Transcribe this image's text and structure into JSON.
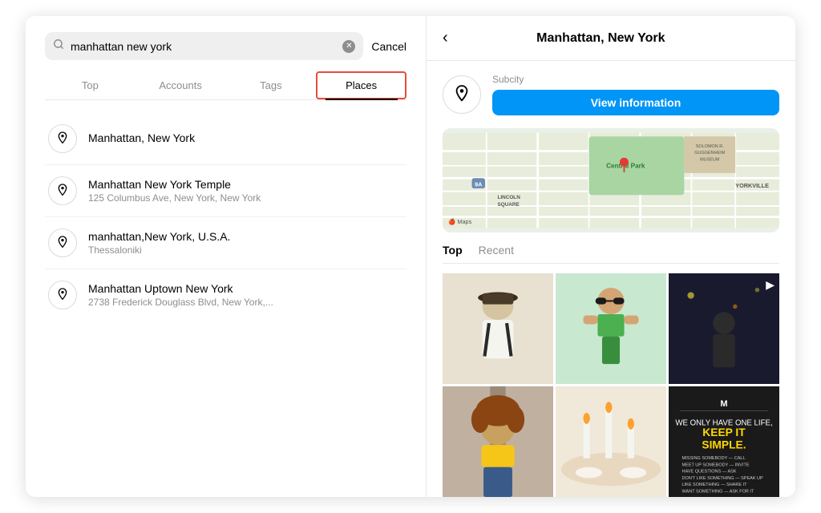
{
  "search": {
    "query": "manhattan new york",
    "placeholder": "Search",
    "cancel_label": "Cancel"
  },
  "tabs": {
    "items": [
      {
        "label": "Top",
        "active": false
      },
      {
        "label": "Accounts",
        "active": false
      },
      {
        "label": "Tags",
        "active": false
      },
      {
        "label": "Places",
        "active": true
      }
    ]
  },
  "results": [
    {
      "title": "Manhattan, New York",
      "subtitle": ""
    },
    {
      "title": "Manhattan New York Temple",
      "subtitle": "125 Columbus Ave, New York, New York"
    },
    {
      "title": "manhattan,New York, U.S.A.",
      "subtitle": "Thessaloniki"
    },
    {
      "title": "Manhattan Uptown New York",
      "subtitle": "2738 Frederick Douglass Blvd, New York,..."
    }
  ],
  "right_panel": {
    "back_label": "‹",
    "title": "Manhattan, New York",
    "subcity_label": "Subcity",
    "view_info_label": "View information",
    "tabs": {
      "top_label": "Top",
      "recent_label": "Recent"
    }
  },
  "photo_grid": {
    "items": [
      {
        "type": "image",
        "description": "person in white shirt with hat"
      },
      {
        "type": "image",
        "description": "woman in green bikini"
      },
      {
        "type": "video",
        "description": "person at night"
      },
      {
        "type": "image",
        "description": "woman with curly hair in elevator"
      },
      {
        "type": "image",
        "description": "table setting with candles"
      },
      {
        "type": "image",
        "description": "motivational text overlay"
      }
    ]
  }
}
